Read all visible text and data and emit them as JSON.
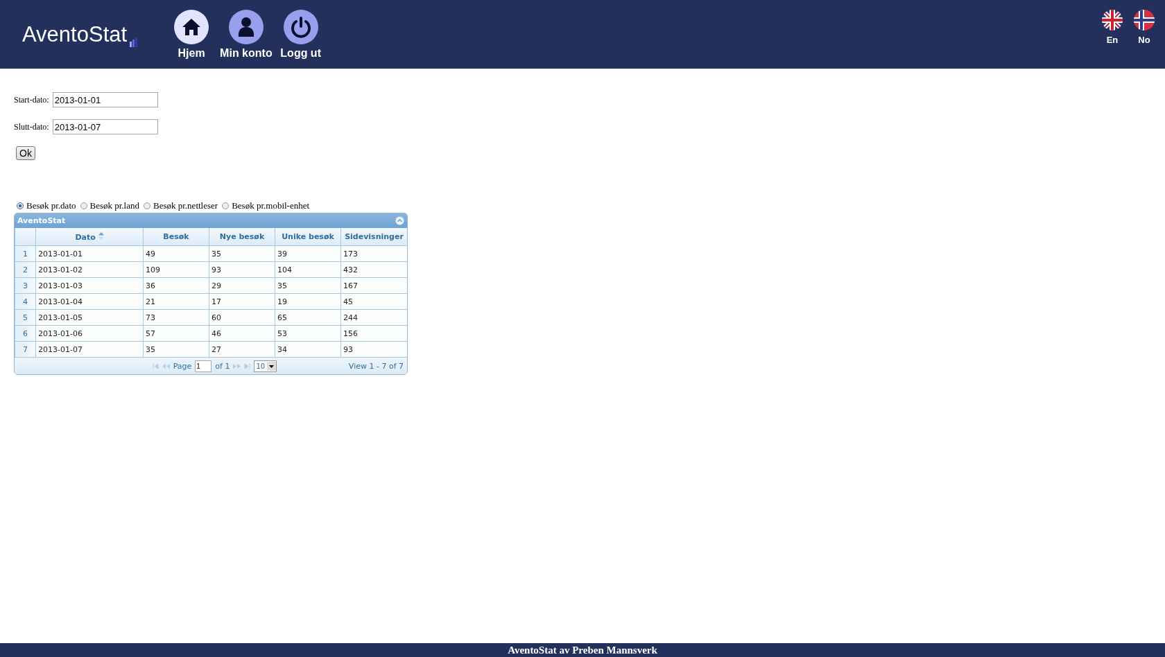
{
  "header": {
    "logo": "AventoStat",
    "nav": [
      {
        "label": "Hjem",
        "kind": "home",
        "selected": true
      },
      {
        "label": "Min konto",
        "kind": "account",
        "selected": false
      },
      {
        "label": "Logg ut",
        "kind": "power",
        "selected": false
      }
    ],
    "languages": [
      {
        "label": "En",
        "kind": "uk"
      },
      {
        "label": "No",
        "kind": "no"
      }
    ]
  },
  "form": {
    "fields": [
      {
        "label": "Start-dato:",
        "value": "2013-01-01"
      },
      {
        "label": "Slutt-dato:",
        "value": "2013-01-07"
      }
    ],
    "button": "Ok"
  },
  "views": [
    {
      "label": "Besøk pr.dato",
      "selected": true
    },
    {
      "label": "Besøk pr.land",
      "selected": false
    },
    {
      "label": "Besøk pr.nettleser",
      "selected": false
    },
    {
      "label": "Besøk pr.mobil-enhet",
      "selected": false
    }
  ],
  "grid": {
    "title": "AventoStat",
    "columns": [
      {
        "label": "Dato",
        "sorted": true
      },
      {
        "label": "Besøk",
        "sorted": false
      },
      {
        "label": "Nye besøk",
        "sorted": false
      },
      {
        "label": "Unike besøk",
        "sorted": false
      },
      {
        "label": "Sidevisninger",
        "sorted": false
      }
    ],
    "rows": [
      {
        "index": "1",
        "cells": [
          "2013-01-01",
          "49",
          "35",
          "39",
          "173"
        ]
      },
      {
        "index": "2",
        "cells": [
          "2013-01-02",
          "109",
          "93",
          "104",
          "432"
        ]
      },
      {
        "index": "3",
        "cells": [
          "2013-01-03",
          "36",
          "29",
          "35",
          "167"
        ]
      },
      {
        "index": "4",
        "cells": [
          "2013-01-04",
          "21",
          "17",
          "19",
          "45"
        ]
      },
      {
        "index": "5",
        "cells": [
          "2013-01-05",
          "73",
          "60",
          "65",
          "244"
        ]
      },
      {
        "index": "6",
        "cells": [
          "2013-01-06",
          "57",
          "46",
          "53",
          "156"
        ]
      },
      {
        "index": "7",
        "cells": [
          "2013-01-07",
          "35",
          "27",
          "34",
          "93"
        ]
      }
    ],
    "pager": {
      "page_label": "Page",
      "page": "1",
      "of": "of 1",
      "page_size": "10",
      "summary": "View 1 - 7 of 7"
    }
  },
  "footer": "AventoStat av Preben Mannsverk"
}
